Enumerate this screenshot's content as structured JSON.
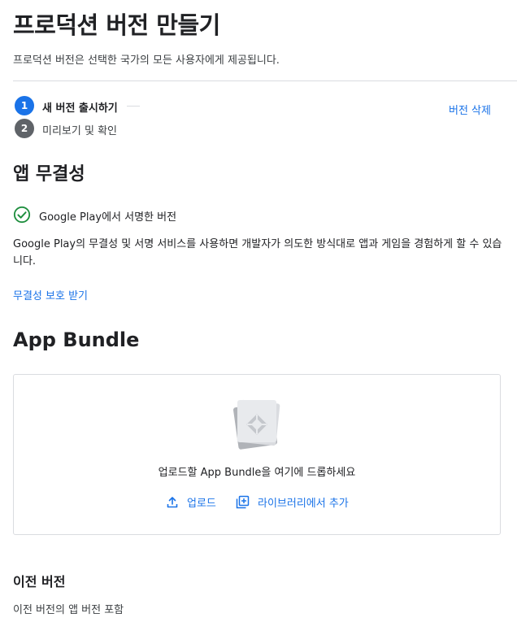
{
  "header": {
    "title": "프로덕션 버전 만들기",
    "subtitle": "프로덕션 버전은 선택한 국가의 모든 사용자에게 제공됩니다."
  },
  "steps": [
    {
      "number": "1",
      "label": "새 버전 출시하기",
      "active": true
    },
    {
      "number": "2",
      "label": "미리보기 및 확인",
      "active": false
    }
  ],
  "delete_link": "버전 삭제",
  "integrity": {
    "title": "앱 무결성",
    "status_text": "Google Play에서 서명한 버전",
    "status_icon": "check-circle-icon",
    "description": "Google Play의 무결성 및 서명 서비스를 사용하면 개발자가 의도한 방식대로 앱과 게임을 경험하게 할 수 있습니다.",
    "link": "무결성 보호 받기"
  },
  "app_bundle": {
    "title": "App Bundle",
    "drop_text": "업로드할 App Bundle을 여기에 드롭하세요",
    "upload_label": "업로드",
    "upload_icon": "upload-icon",
    "library_label": "라이브러리에서 추가",
    "library_icon": "add-box-icon",
    "bundle_icon": "app-bundle-icon"
  },
  "previous_versions": {
    "title": "이전 버전",
    "description": "이전 버전의 앱 버전 포함"
  },
  "colors": {
    "accent": "#1a73e8",
    "success": "#1e8e3e",
    "step_inactive": "#5f6368",
    "border": "#dadce0"
  }
}
